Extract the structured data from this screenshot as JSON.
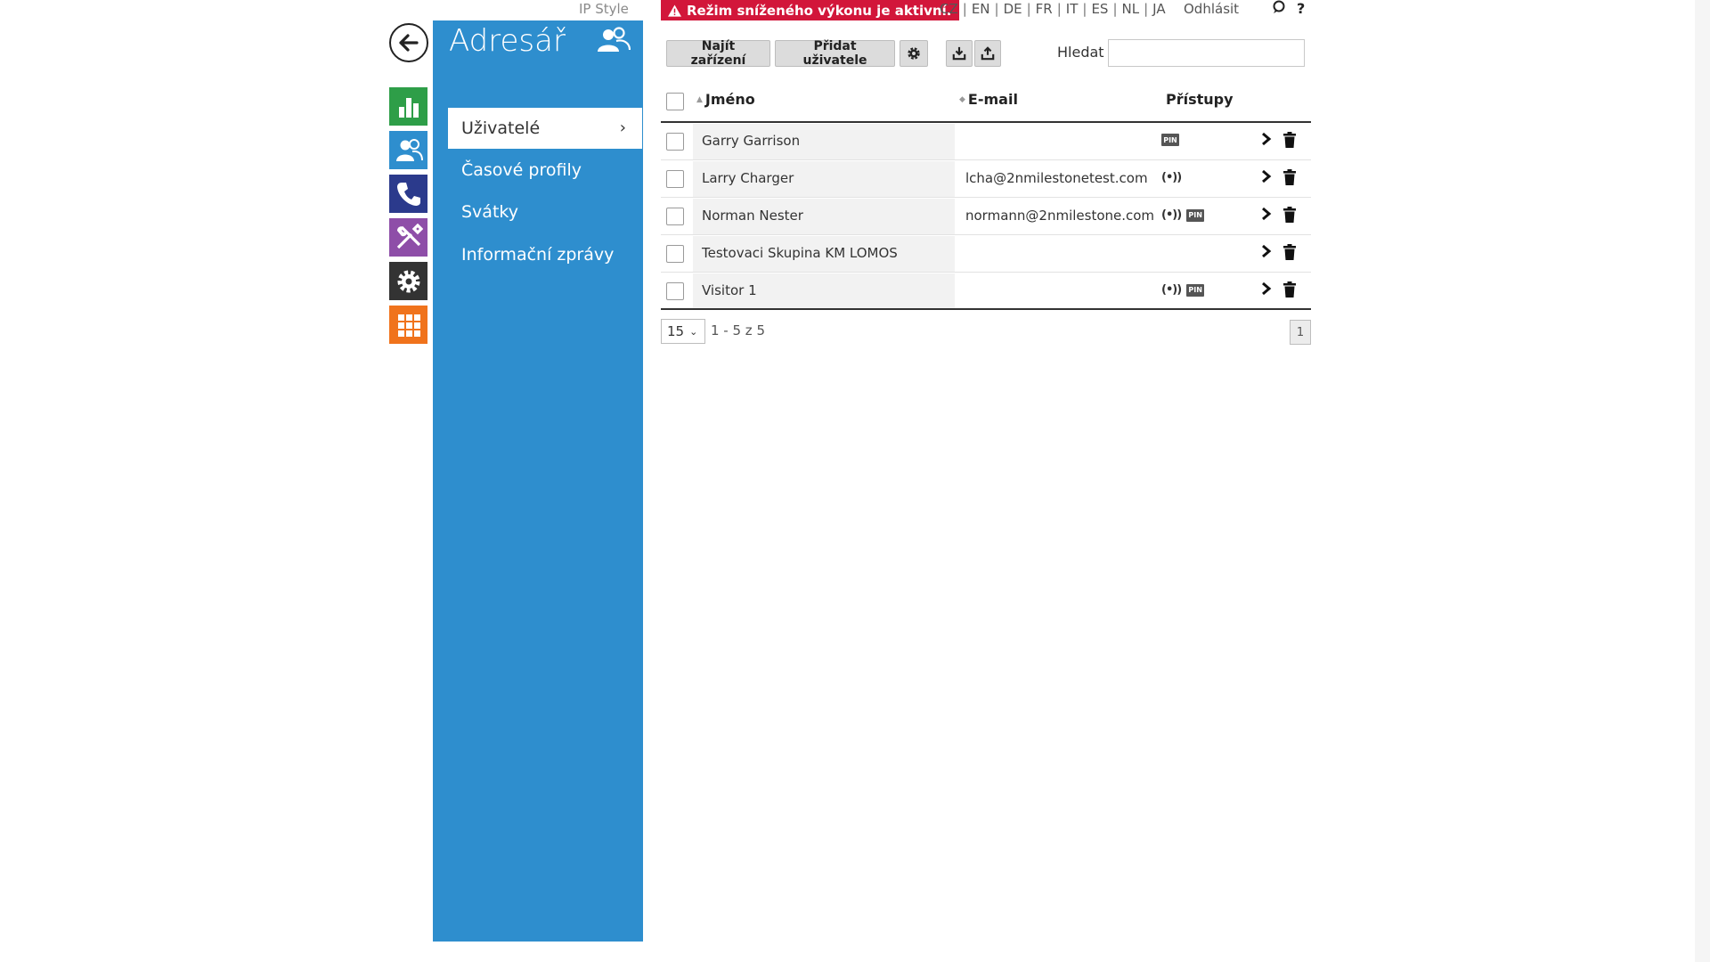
{
  "brand": "IP Style",
  "alert": {
    "text": "Režim sníženého výkonu je aktivní."
  },
  "languages": [
    "CZ",
    "EN",
    "DE",
    "FR",
    "IT",
    "ES",
    "NL",
    "JA"
  ],
  "logout": "Odhlásit",
  "help": "?",
  "panel": {
    "title": "Adresář",
    "menu": [
      {
        "label": "Uživatelé",
        "active": true
      },
      {
        "label": "Časové profily"
      },
      {
        "label": "Svátky"
      },
      {
        "label": "Informační zprávy"
      }
    ]
  },
  "rail": {
    "colors": [
      "#2e9e48",
      "#2e8ece",
      "#2b3a8c",
      "#8e4ea8",
      "#333333",
      "#f0731c"
    ],
    "icons": [
      "status-icon",
      "directory-icon",
      "phone-icon",
      "tools-icon",
      "settings-icon",
      "apps-icon"
    ]
  },
  "toolbar": {
    "find_devices": "Najít zařízení",
    "add_user": "Přidat uživatele",
    "search_label": "Hledat",
    "search_value": ""
  },
  "table": {
    "columns": {
      "name": "Jméno",
      "email": "E-mail",
      "access": "Přístupy"
    },
    "rows": [
      {
        "name": "Garry Garrison",
        "email": "",
        "access": [
          "pin"
        ]
      },
      {
        "name": "Larry Charger",
        "email": "lcha@2nmilestonetest.com",
        "access": [
          "rfid"
        ]
      },
      {
        "name": "Norman Nester",
        "email": "normann@2nmilestone.com",
        "access": [
          "rfid",
          "pin"
        ]
      },
      {
        "name": "Testovaci Skupina KM LOMOS",
        "email": "",
        "access": []
      },
      {
        "name": "Visitor 1",
        "email": "",
        "access": [
          "rfid",
          "pin"
        ]
      }
    ],
    "pin_label": "PIN",
    "rfid_label": "(•))"
  },
  "footer": {
    "page_size": "15",
    "range": "1 - 5 z 5",
    "page": "1"
  },
  "colors": {
    "accent": "#2e8ece",
    "alert": "#d2163a"
  }
}
